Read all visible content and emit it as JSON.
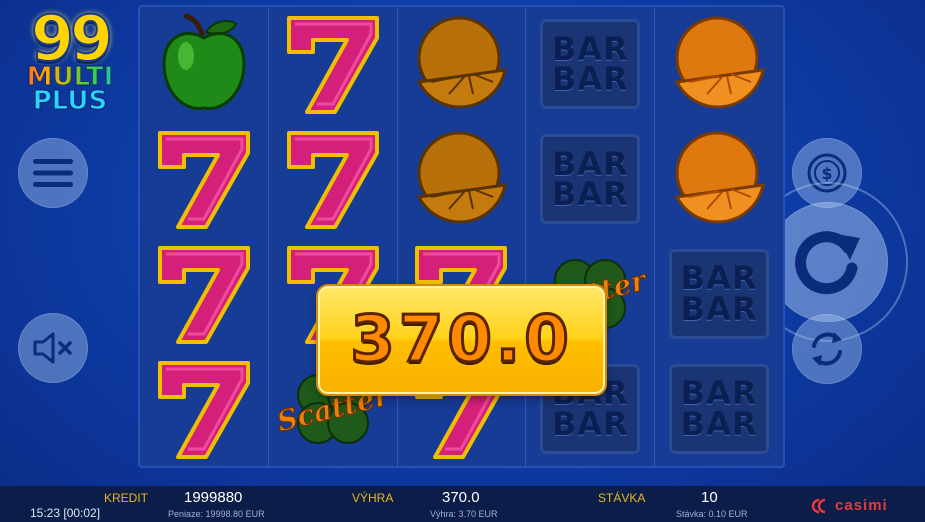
{
  "logo": {
    "line1": "99",
    "line2": "MULTI",
    "line3": "PLUS"
  },
  "buttons": {
    "menu": {
      "icon": "hamburger-menu-icon"
    },
    "mute": {
      "icon": "speaker-muted-icon"
    },
    "bet": {
      "icon": "dollar-coin-icon"
    },
    "spin": {
      "icon": "spin-arrow-icon"
    },
    "autoplay": {
      "icon": "autoplay-cycle-icon"
    }
  },
  "reels": [
    [
      "apple",
      "seven",
      "seven",
      "seven"
    ],
    [
      "seven",
      "seven",
      "seven",
      "scatter"
    ],
    [
      "orange",
      "orange",
      "seven",
      "seven"
    ],
    [
      "bar",
      "bar",
      "scatter",
      "bar"
    ],
    [
      "orange",
      "orange",
      "bar",
      "bar"
    ]
  ],
  "symbols": {
    "bar_line1": "BAR",
    "bar_line2": "BAR",
    "scatter": "Scatter"
  },
  "win_popup": {
    "value": "370.0"
  },
  "bottom_bar": {
    "clock": "15:23 [00:02]",
    "credit": {
      "label": "KREDIT",
      "value": "1999880",
      "sub": "Peniaze: 19998.80 EUR"
    },
    "win": {
      "label": "VÝHRA",
      "value": "370.0",
      "sub": "Výhra: 3.70 EUR"
    },
    "bet": {
      "label": "STÁVKA",
      "value": "10",
      "sub": "Stávka: 0.10 EUR"
    },
    "brand": "casimi"
  },
  "colors": {
    "background": "#0d3aa3",
    "reel_bg": "#173c96",
    "seven": "#d4207a",
    "gold": "#ffd21a",
    "label_gold": "#e9b81a",
    "brand_red": "#e83a3a"
  }
}
